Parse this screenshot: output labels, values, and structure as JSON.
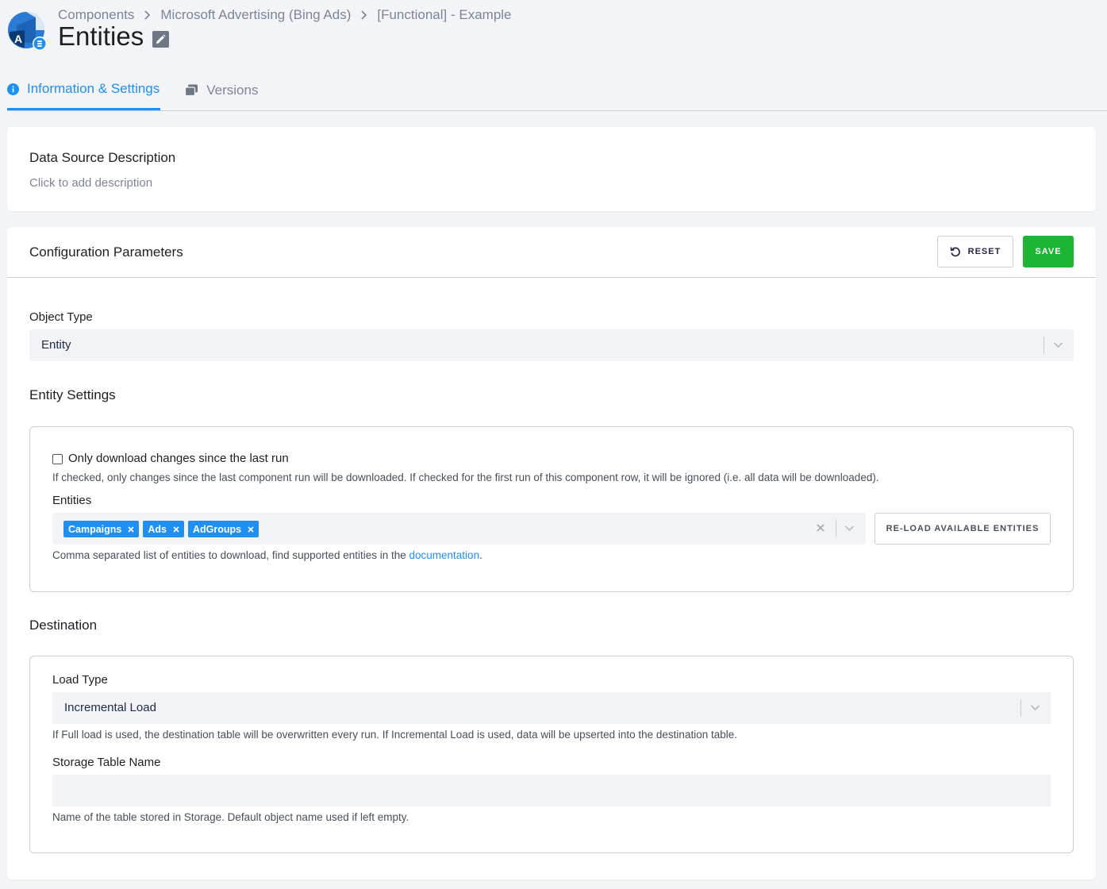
{
  "breadcrumb": {
    "items": [
      "Components",
      "Microsoft Advertising (Bing Ads)",
      "[Functional] - Example"
    ]
  },
  "page": {
    "title": "Entities"
  },
  "tabs": [
    {
      "label": "Information & Settings",
      "icon": "info-icon",
      "active": true
    },
    {
      "label": "Versions",
      "icon": "versions-icon",
      "active": false
    }
  ],
  "description_card": {
    "title": "Data Source Description",
    "placeholder": "Click to add description"
  },
  "config": {
    "title": "Configuration Parameters",
    "reset_label": "RESET",
    "save_label": "SAVE",
    "object_type": {
      "label": "Object Type",
      "value": "Entity"
    },
    "entity_settings": {
      "title": "Entity Settings",
      "incremental_checkbox": {
        "label": "Only download changes since the last run",
        "checked": false,
        "help": "If checked, only changes since the last component run will be downloaded. If checked for the first run of this component row, it will be ignored (i.e. all data will be downloaded)."
      },
      "entities": {
        "label": "Entities",
        "selected": [
          "Campaigns",
          "Ads",
          "AdGroups"
        ],
        "reload_label": "RE-LOAD AVAILABLE ENTITIES",
        "help_prefix": "Comma separated list of entities to download, find supported entities in the ",
        "help_link": "documentation",
        "help_suffix": "."
      }
    },
    "destination": {
      "title": "Destination",
      "load_type": {
        "label": "Load Type",
        "value": "Incremental Load",
        "help": "If Full load is used, the destination table will be overwritten every run. If Incremental Load is used, data will be upserted into the destination table."
      },
      "storage_table": {
        "label": "Storage Table Name",
        "value": "",
        "placeholder": "",
        "help": "Name of the table stored in Storage. Default object name used if left empty."
      }
    }
  },
  "colors": {
    "accent": "#1f8ff2",
    "save": "#1fb534",
    "background": "#f2f4f7"
  }
}
